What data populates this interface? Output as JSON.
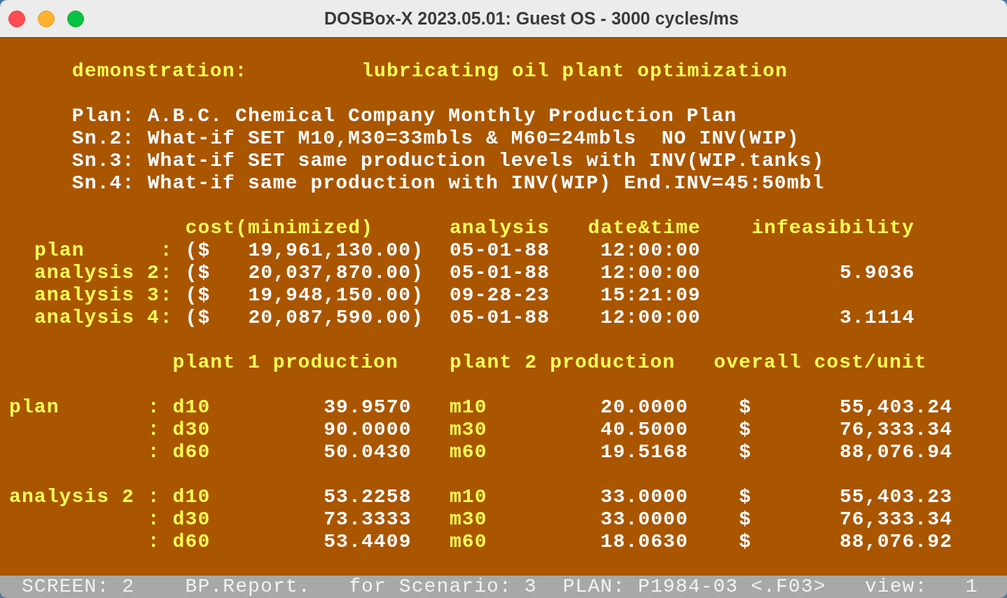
{
  "window": {
    "title": "DOSBox-X 2023.05.01: Guest OS - 3000 cycles/ms"
  },
  "header": {
    "label": "demonstration:",
    "title": "lubricating oil plant optimization"
  },
  "scenarios": [
    {
      "label": "Plan:",
      "text": "A.B.C. Chemical Company Monthly Production Plan"
    },
    {
      "label": "Sn.2:",
      "text": "What-if SET M10,M30=33mbls & M60=24mbls  NO INV(WIP)"
    },
    {
      "label": "Sn.3:",
      "text": "What-if SET same production levels with INV(WIP.tanks)"
    },
    {
      "label": "Sn.4:",
      "text": "What-if same production with INV(WIP) End.INV=45:50mbl"
    }
  ],
  "summary": {
    "columns": [
      "cost(minimized)",
      "analysis",
      "date&time",
      "infeasibility"
    ],
    "rows": [
      {
        "label": "plan",
        "separator": ":",
        "currency": "($",
        "cost": "19,961,130.00)",
        "date": "05-01-88",
        "time": "12:00:00"
      },
      {
        "label": "analysis 2",
        "separator": ":",
        "currency": "($",
        "cost": "20,037,870.00)",
        "date": "05-01-88",
        "time": "12:00:00",
        "infeasibility": "5.9036"
      },
      {
        "label": "analysis 3",
        "separator": ":",
        "currency": "($",
        "cost": "19,948,150.00)",
        "date": "09-28-23",
        "time": "15:21:09"
      },
      {
        "label": "analysis 4",
        "separator": ":",
        "currency": "($",
        "cost": "20,087,590.00)",
        "date": "05-01-88",
        "time": "12:00:00",
        "infeasibility": "3.1114"
      }
    ]
  },
  "production": {
    "columns": [
      "plant 1 production",
      "plant 2 production",
      "overall cost/unit"
    ],
    "groups": [
      {
        "label": "plan",
        "rows": [
          {
            "separator": ":",
            "plant1_unit": "d10",
            "plant1_value": "39.9570",
            "plant2_unit": "m10",
            "plant2_value": "20.0000",
            "currency": "$",
            "cost": "55,403.24"
          },
          {
            "separator": ":",
            "plant1_unit": "d30",
            "plant1_value": "90.0000",
            "plant2_unit": "m30",
            "plant2_value": "40.5000",
            "currency": "$",
            "cost": "76,333.34"
          },
          {
            "separator": ":",
            "plant1_unit": "d60",
            "plant1_value": "50.0430",
            "plant2_unit": "m60",
            "plant2_value": "19.5168",
            "currency": "$",
            "cost": "88,076.94"
          }
        ]
      },
      {
        "label": "analysis 2",
        "rows": [
          {
            "separator": ":",
            "plant1_unit": "d10",
            "plant1_value": "53.2258",
            "plant2_unit": "m10",
            "plant2_value": "33.0000",
            "currency": "$",
            "cost": "55,403.23"
          },
          {
            "separator": ":",
            "plant1_unit": "d30",
            "plant1_value": "73.3333",
            "plant2_unit": "m30",
            "plant2_value": "33.0000",
            "currency": "$",
            "cost": "76,333.34"
          },
          {
            "separator": ":",
            "plant1_unit": "d60",
            "plant1_value": "53.4409",
            "plant2_unit": "m60",
            "plant2_value": "18.0630",
            "currency": "$",
            "cost": "88,076.92"
          }
        ]
      }
    ]
  },
  "status_bar": {
    "screen": "SCREEN: 2",
    "report": "BP.Report.",
    "scenario": "for Scenario: 3",
    "plan": "PLAN: P1984-03 <.F03>",
    "view_label": "view:",
    "view_value": "1"
  }
}
